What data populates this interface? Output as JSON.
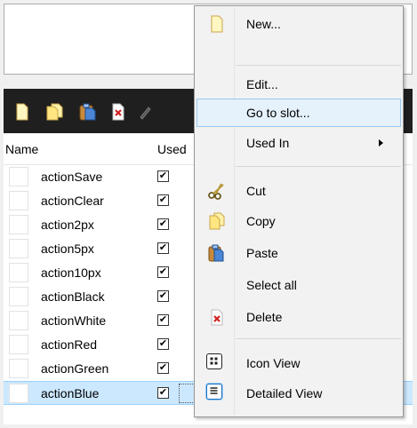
{
  "toolbar": {
    "icons": [
      "new-doc-icon",
      "copy-doc-icon",
      "paste-doc-icon",
      "delete-doc-icon",
      "edit-pen-icon"
    ]
  },
  "columns": {
    "name": "Name",
    "used": "Used"
  },
  "rows": [
    {
      "name": "actionSave",
      "used": true
    },
    {
      "name": "actionClear",
      "used": true
    },
    {
      "name": "action2px",
      "used": true
    },
    {
      "name": "action5px",
      "used": true
    },
    {
      "name": "action10px",
      "used": true
    },
    {
      "name": "actionBlack",
      "used": true
    },
    {
      "name": "actionWhite",
      "used": true
    },
    {
      "name": "actionRed",
      "used": true
    },
    {
      "name": "actionGreen",
      "used": true
    },
    {
      "name": "actionBlue",
      "used": true,
      "extra": "Blue",
      "selected": true
    }
  ],
  "context_menu": {
    "items": [
      {
        "label": "New...",
        "icon": "new-doc-icon"
      },
      {
        "label": "Edit...",
        "icon": ""
      },
      {
        "label": "Go to slot...",
        "icon": "",
        "highlighted": true
      },
      {
        "label": "Used In",
        "icon": "",
        "submenu": true
      },
      {
        "label": "Cut",
        "icon": "scissors-icon"
      },
      {
        "label": "Copy",
        "icon": "copy-doc-icon"
      },
      {
        "label": "Paste",
        "icon": "paste-doc-icon"
      },
      {
        "label": "Select all",
        "icon": ""
      },
      {
        "label": "Delete",
        "icon": "delete-doc-icon"
      },
      {
        "label": "Icon View",
        "icon": "icon-view-icon"
      },
      {
        "label": "Detailed View",
        "icon": "detailed-view-icon"
      }
    ]
  },
  "colors": {
    "toolbar_bg": "#1f1f1f",
    "selected_row": "#cce8ff",
    "menu_bg": "#f2f2f2",
    "menu_highlight": "#e5f1fb"
  }
}
